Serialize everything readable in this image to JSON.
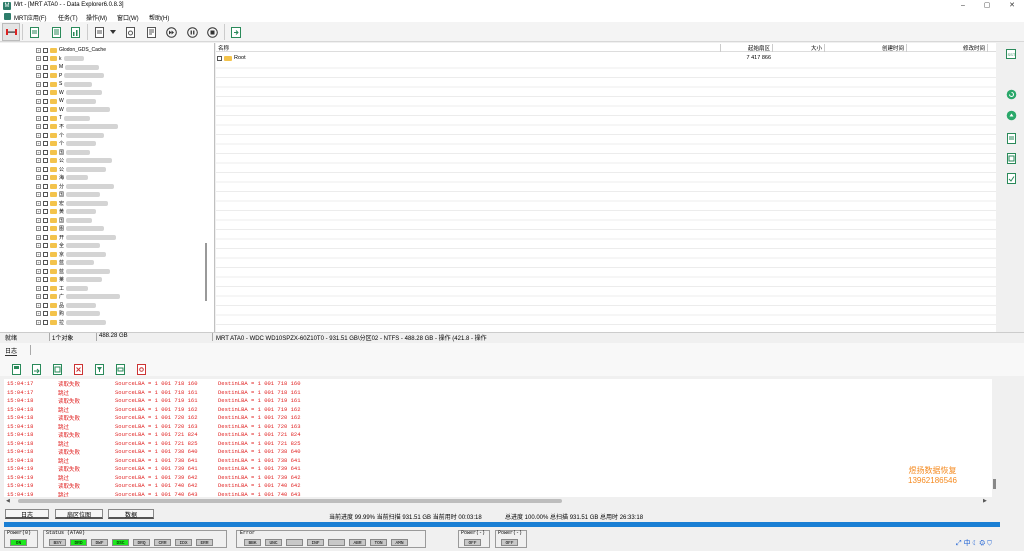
{
  "window": {
    "title": "Mrt - [MRT ATA0 - - Data Explorer6.0.8.3]",
    "icon": "app-icon"
  },
  "menu": [
    "MRT应用(F)",
    "任务(T)",
    "操作(M)",
    "窗口(W)",
    "帮助(H)"
  ],
  "tree": {
    "items": [
      {
        "label": "Glodon_GDS_Cache"
      },
      {
        "label": "k"
      },
      {
        "label": "M"
      },
      {
        "label": "P"
      },
      {
        "label": "S"
      },
      {
        "label": "W"
      },
      {
        "label": "W"
      },
      {
        "label": "W"
      },
      {
        "label": "T"
      },
      {
        "label": "不"
      },
      {
        "label": "个"
      },
      {
        "label": "个"
      },
      {
        "label": "国"
      },
      {
        "label": "公"
      },
      {
        "label": "公"
      },
      {
        "label": "海"
      },
      {
        "label": "分"
      },
      {
        "label": "国"
      },
      {
        "label": "宏"
      },
      {
        "label": "黄"
      },
      {
        "label": "国"
      },
      {
        "label": "图"
      },
      {
        "label": "开"
      },
      {
        "label": "全"
      },
      {
        "label": "京"
      },
      {
        "label": "蓝"
      },
      {
        "label": "蓝"
      },
      {
        "label": "莱"
      },
      {
        "label": "工"
      },
      {
        "label": "广"
      },
      {
        "label": "品"
      },
      {
        "label": "购"
      },
      {
        "label": "拉"
      }
    ]
  },
  "filelist": {
    "columns": [
      "名称",
      "起始扇区",
      "大小",
      "创建时间",
      "修改时间"
    ],
    "rows": [
      {
        "name": "Root",
        "start_sector": "7 417 866",
        "size": "",
        "created": "",
        "modified": ""
      }
    ]
  },
  "statusbar": {
    "state": "就绪",
    "count": "1个对象",
    "size": "488.28 GB",
    "path": "MRT ATA0 - WDC WD10SPZX-60Z10T0 - 931.51 GB\\分区02 - NTFS - 488.28 GB - 操作 (421.8 - 操作"
  },
  "log": {
    "tab_label": "日志",
    "rows": [
      {
        "time": "15:04:17",
        "action": "读取失败",
        "src": "SourceLBA = 1 001 718 160",
        "dst": "DestinLBA =  1 001 718 160"
      },
      {
        "time": "15:04:17",
        "action": "跳过",
        "src": "SourceLBA = 1 001 718 161",
        "dst": "DestinLBA =  1 001 718 161"
      },
      {
        "time": "15:04:18",
        "action": "读取失败",
        "src": "SourceLBA = 1 001 719 161",
        "dst": "DestinLBA =  1 001 719 161"
      },
      {
        "time": "15:04:18",
        "action": "跳过",
        "src": "SourceLBA = 1 001 719 162",
        "dst": "DestinLBA =  1 001 719 162"
      },
      {
        "time": "15:04:18",
        "action": "读取失败",
        "src": "SourceLBA = 1 001 720 162",
        "dst": "DestinLBA =  1 001 720 162"
      },
      {
        "time": "15:04:18",
        "action": "跳过",
        "src": "SourceLBA = 1 001 720 163",
        "dst": "DestinLBA =  1 001 720 163"
      },
      {
        "time": "15:04:18",
        "action": "读取失败",
        "src": "SourceLBA = 1 001 721 824",
        "dst": "DestinLBA =  1 001 721 824"
      },
      {
        "time": "15:04:18",
        "action": "跳过",
        "src": "SourceLBA = 1 001 721 825",
        "dst": "DestinLBA =  1 001 721 825"
      },
      {
        "time": "15:04:18",
        "action": "读取失败",
        "src": "SourceLBA = 1 001 738 640",
        "dst": "DestinLBA =  1 001 738 640"
      },
      {
        "time": "15:04:18",
        "action": "跳过",
        "src": "SourceLBA = 1 001 738 641",
        "dst": "DestinLBA =  1 001 738 641"
      },
      {
        "time": "15:04:19",
        "action": "读取失败",
        "src": "SourceLBA = 1 001 739 641",
        "dst": "DestinLBA =  1 001 739 641"
      },
      {
        "time": "15:04:19",
        "action": "跳过",
        "src": "SourceLBA = 1 001 739 642",
        "dst": "DestinLBA =  1 001 739 642"
      },
      {
        "time": "15:04:19",
        "action": "读取失败",
        "src": "SourceLBA = 1 001 740 642",
        "dst": "DestinLBA =  1 001 740 642"
      },
      {
        "time": "15:04:19",
        "action": "跳过",
        "src": "SourceLBA = 1 001 740 643",
        "dst": "DestinLBA =  1 001 740 643"
      }
    ]
  },
  "watermark": {
    "line1": "煜扬数据恢复",
    "line2": "13962186546"
  },
  "bottom_tabs": [
    "日志",
    "扇区位图",
    "数据"
  ],
  "progress": {
    "current": "当前进度 99.99% 当前扫描 931.51 GB 当前用时 00:03:18",
    "total": "总进度 100.00% 总扫描 931.51 GB 总用时 26:33:18",
    "fraction": 0.9999
  },
  "device": {
    "power0_label": "Power(0)",
    "power0_led": "ON",
    "status_label": "Status (ATA0)",
    "status_leds": [
      "BSY",
      "DRD",
      "DWF",
      "DSC",
      "DRQ",
      "CRR",
      "IDX",
      "ERR"
    ],
    "status_on": [
      "DRD",
      "DSC"
    ],
    "error_label": "Error",
    "error_leds": [
      "BBK",
      "UNC",
      "",
      "INF",
      "",
      "ABR",
      "TON",
      "AMN"
    ],
    "power_a_label": "Power(-)",
    "power_a_led": "OFF",
    "power_b_label": "Power(-)",
    "power_b_led": "OFF"
  },
  "tray": {
    "ime": "中"
  }
}
